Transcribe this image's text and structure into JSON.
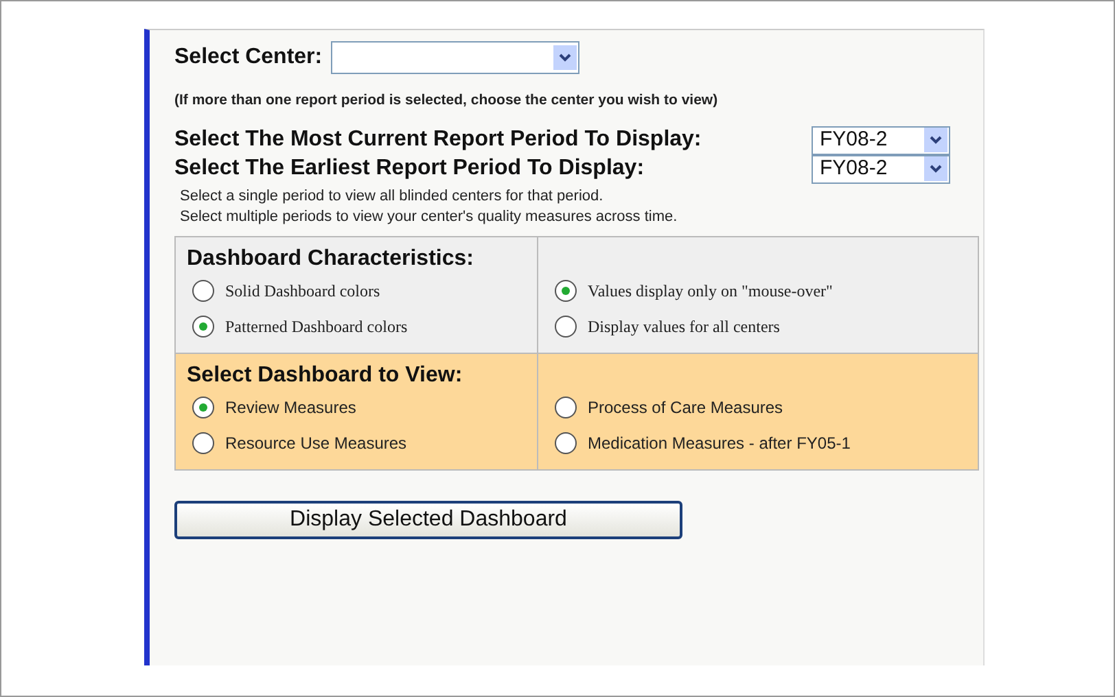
{
  "center": {
    "label": "Select Center:",
    "hint": "(If more than one report period is selected, choose the center you wish to view)"
  },
  "periods": [
    {
      "label": "Select The Most Current Report Period To Display:",
      "value": "FY08-2"
    },
    {
      "label": "Select The Earliest Report Period To Display:",
      "value": "FY08-2"
    }
  ],
  "period_help": [
    "Select a single period to view all blinded centers for that period.",
    "Select multiple periods to view your center's quality measures across time."
  ],
  "characteristics": {
    "title": "Dashboard Characteristics:",
    "columns": [
      [
        {
          "label": "Solid Dashboard colors",
          "selected": false
        },
        {
          "label": "Patterned Dashboard colors",
          "selected": true
        }
      ],
      [
        {
          "label": "Values display only on \"mouse-over\"",
          "selected": true
        },
        {
          "label": "Display values for all centers",
          "selected": false
        }
      ]
    ]
  },
  "dashboards": {
    "title": "Select Dashboard to View:",
    "columns": [
      [
        {
          "label": "Review Measures",
          "selected": true
        },
        {
          "label": "Resource Use Measures",
          "selected": false
        }
      ],
      [
        {
          "label": "Process of Care Measures",
          "selected": false
        },
        {
          "label": "Medication Measures - after FY05-1",
          "selected": false
        }
      ]
    ]
  },
  "button": "Display Selected Dashboard"
}
